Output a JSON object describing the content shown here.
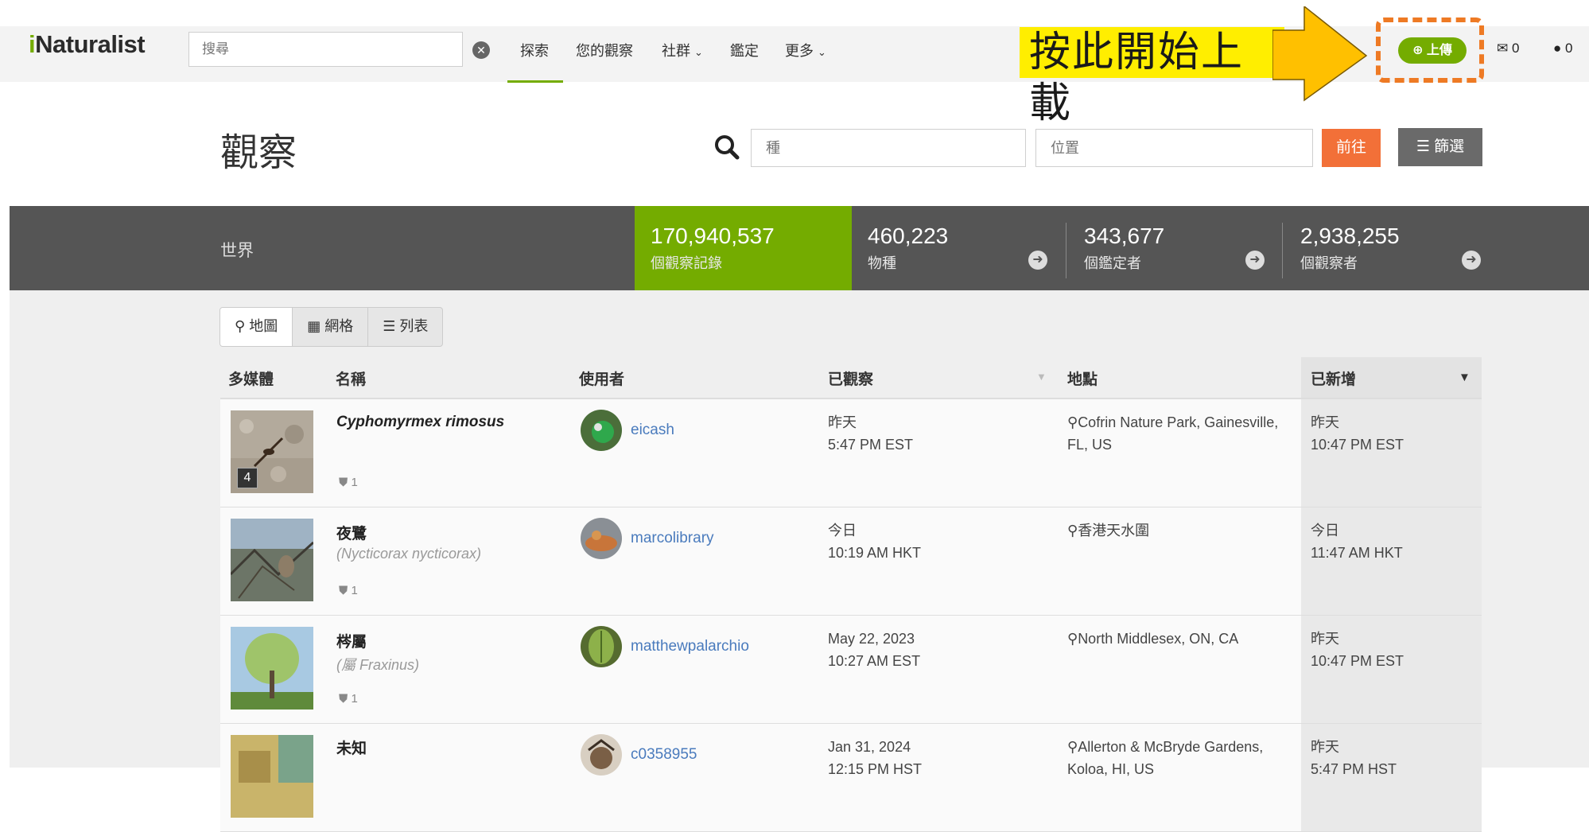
{
  "nav": {
    "logo_i": "i",
    "logo_rest": "Naturalist",
    "search_placeholder": "搜尋",
    "clear": "✕",
    "items": [
      "探索",
      "您的觀察",
      "社群",
      "鑑定",
      "更多"
    ],
    "upload": "上傳",
    "messages": "0",
    "notifications": "0"
  },
  "callout": {
    "text": "按此開始上載"
  },
  "page": {
    "title": "觀察",
    "species_placeholder": "種",
    "place_placeholder": "位置",
    "go": "前往",
    "filter": "篩選"
  },
  "stats": {
    "place": "世界",
    "observations": {
      "value": "170,940,537",
      "label": "個觀察記錄"
    },
    "species": {
      "value": "460,223",
      "label": "物種"
    },
    "identifiers": {
      "value": "343,677",
      "label": "個鑑定者"
    },
    "observers": {
      "value": "2,938,255",
      "label": "個觀察者"
    }
  },
  "view_toggle": [
    "地圖",
    "網格",
    "列表"
  ],
  "table": {
    "headers": [
      "多媒體",
      "名稱",
      "使用者",
      "已觀察",
      "地點",
      "已新增"
    ],
    "rows": [
      {
        "photo_count": "4",
        "name": "Cyphomyrmex rimosus",
        "sub": "",
        "ids": "1",
        "user": "eicash",
        "observed_date": "昨天",
        "observed_time": "5:47 PM EST",
        "place_l1": "Cofrin Nature Park, Gainesville,",
        "place_l2": "FL, US",
        "added_date": "昨天",
        "added_time": "10:47 PM EST"
      },
      {
        "photo_count": "",
        "name": "夜鷺",
        "sub": "(Nycticorax nycticorax)",
        "ids": "1",
        "user": "marcolibrary",
        "observed_date": "今日",
        "observed_time": "10:19 AM HKT",
        "place_l1": "香港天水圍",
        "place_l2": "",
        "added_date": "今日",
        "added_time": "11:47 AM HKT"
      },
      {
        "photo_count": "",
        "name": "梣屬",
        "sub": "(屬 Fraxinus)",
        "ids": "1",
        "user": "matthewpalarchio",
        "observed_date": "May 22, 2023",
        "observed_time": "10:27 AM EST",
        "place_l1": "North Middlesex, ON, CA",
        "place_l2": "",
        "added_date": "昨天",
        "added_time": "10:47 PM EST"
      },
      {
        "photo_count": "",
        "name": "未知",
        "sub": "",
        "ids": "",
        "user": "c0358955",
        "observed_date": "Jan 31, 2024",
        "observed_time": "12:15 PM HST",
        "place_l1": "Allerton & McBryde Gardens,",
        "place_l2": "Koloa, HI, US",
        "added_date": "昨天",
        "added_time": "5:47 PM HST"
      }
    ]
  },
  "colors": {
    "brand_green": "#74ac00",
    "accent_orange": "#f27038",
    "callout_yellow": "#ffee00",
    "link_blue": "#4a7bbd"
  }
}
